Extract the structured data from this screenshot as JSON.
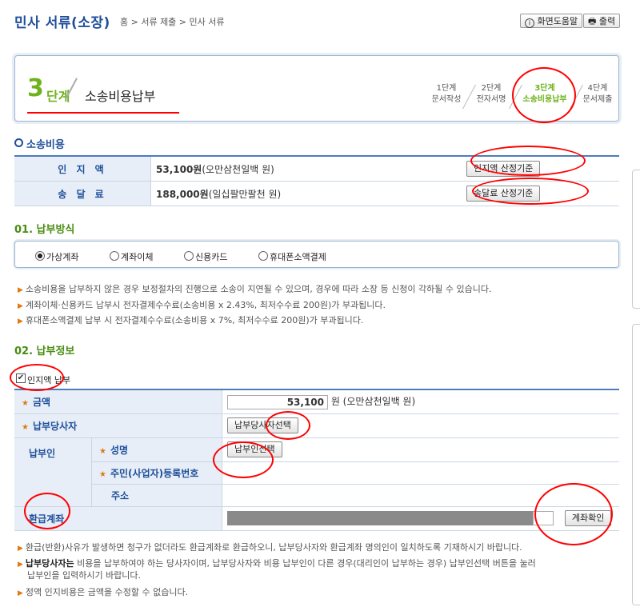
{
  "header": {
    "title": "민사 서류(소장)",
    "breadcrumb": "홈 > 서류 제출 > 민사 서류",
    "help_label": "화면도움말",
    "print_label": "출력",
    "help_icon": "info-circle-icon",
    "print_icon": "printer-icon"
  },
  "steps": {
    "current_number": "3",
    "current_word": "단계",
    "current_title": "소송비용납부",
    "items": [
      {
        "step": "1단계",
        "label": "문서작성"
      },
      {
        "step": "2단계",
        "label": "전자서명"
      },
      {
        "step": "3단계",
        "label": "소송비용납부"
      },
      {
        "step": "4단계",
        "label": "문서제출"
      }
    ],
    "active_index": 2
  },
  "cost": {
    "heading": "소송비용",
    "rows": [
      {
        "label": "인 지 액",
        "value": "53,100원",
        "value_words": "(오만삼천일백 원)",
        "button": "인지액 산정기준"
      },
      {
        "label": "송 달 료",
        "value": "188,000원",
        "value_words": "(일십팔만팔천 원)",
        "button": "송달료 산정기준"
      }
    ]
  },
  "method": {
    "heading": "01. 납부방식",
    "options": [
      "가상계좌",
      "계좌이체",
      "신용카드",
      "휴대폰소액결제"
    ],
    "selected_index": 0,
    "notes": [
      "소송비용을 납부하지 않은 경우 보정절차의 진행으로 소송이 지연될 수 있으며, 경우에 따라 소장 등 신청이 각하될 수 있습니다.",
      "계좌이체·신용카드 납부시 전자결제수수료(소송비용 x 2.43%, 최저수수료 200원)가 부과됩니다.",
      "휴대폰소액결제 납부 시 전자결제수수료(소송비용 x 7%, 최저수수료 200원)가 부과됩니다."
    ]
  },
  "payinfo": {
    "heading": "02. 납부정보",
    "checkbox_label": "인지액 납부",
    "checkbox_checked": true,
    "amount_label": "금액",
    "amount_value": "53,100",
    "amount_suffix": "원 (오만삼천일백 원)",
    "party_label": "납부당사자",
    "party_button": "납부당사자선택",
    "payer_label": "납부인",
    "name_label": "성명",
    "name_button": "납부인선택",
    "regno_label": "주민(사업자)등록번호",
    "address_label": "주소",
    "refund_label": "환급계좌",
    "refund_button": "계좌확인",
    "notes": [
      {
        "bold": "",
        "text": "환급(반환)사유가 발생하면 청구가 없더라도 환급계좌로 환급하오니, 납부당사자와 환급계좌 명의인이 일치하도록 기재하시기 바랍니다."
      },
      {
        "bold": "납부당사자는",
        "text": " 비용을 납부하여야 하는 당사자이며, 납부당사자와 비용 납부인이 다른 경우(대리인이 납부하는 경우) 납부인선택 버튼을 눌러"
      },
      {
        "bold": "",
        "text": "납부인을 입력하시기 바랍니다."
      },
      {
        "bold": "",
        "text": "정액 인지비용은 금액을 수정할 수 없습니다."
      }
    ]
  },
  "colors": {
    "accent_blue": "#1f4f9a",
    "accent_green": "#6fb21e",
    "annotation_red": "#ff0000",
    "masked_gray": "#8a8a8a"
  }
}
